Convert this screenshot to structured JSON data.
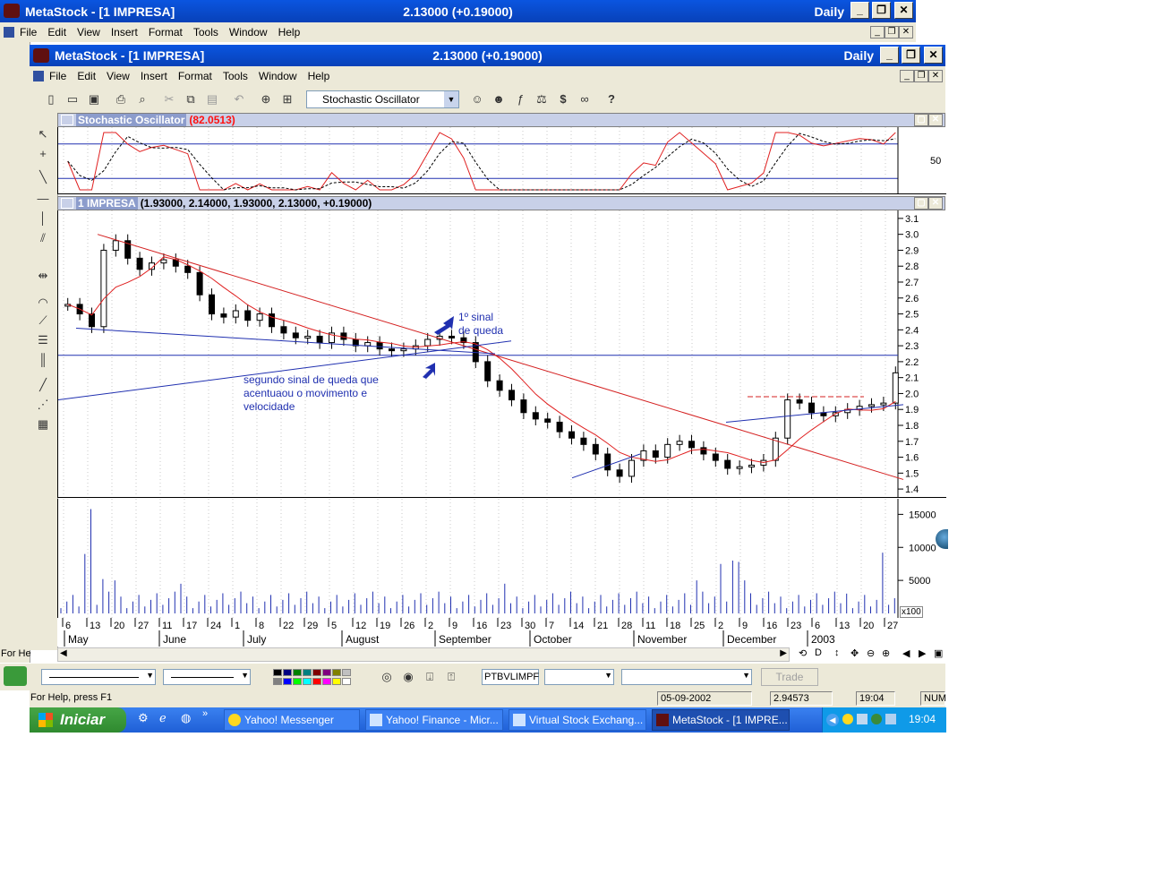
{
  "outer_window": {
    "title": "MetaStock - [1 IMPRESA]",
    "center": "2.13000 (+0.19000)",
    "period": "Daily"
  },
  "outer_menu": [
    "File",
    "Edit",
    "View",
    "Insert",
    "Format",
    "Tools",
    "Window",
    "Help"
  ],
  "inner_window": {
    "title": "MetaStock - [1 IMPRESA]",
    "center": "2.13000 (+0.19000)",
    "period": "Daily"
  },
  "inner_menu": [
    "File",
    "Edit",
    "View",
    "Insert",
    "Format",
    "Tools",
    "Window",
    "Help"
  ],
  "toolbar": {
    "indicator_select": "Stochastic Oscillator"
  },
  "stoch_pane": {
    "label": "Stochastic Oscillator",
    "value": "(82.0513)",
    "tick_50": "50"
  },
  "price_pane": {
    "label": "1 IMPRESA",
    "values": "(1.93000, 2.14000, 1.93000, 2.13000, +0.19000)"
  },
  "annotations": {
    "first_signal_line1": "1º sinal",
    "first_signal_line2": "de queda",
    "second_signal_line1": "segundo sinal de queda que",
    "second_signal_line2": "acentuaou o movimento e",
    "second_signal_line3": "velocidade"
  },
  "chart_data": {
    "type": "candlestick",
    "price_axis_ticks": [
      "3.1",
      "3.0",
      "2.9",
      "2.8",
      "2.7",
      "2.6",
      "2.5",
      "2.4",
      "2.3",
      "2.2",
      "2.1",
      "2.0",
      "1.9",
      "1.8",
      "1.7",
      "1.6",
      "1.5",
      "1.4"
    ],
    "volume_axis_ticks": [
      "15000",
      "10000",
      "5000"
    ],
    "volume_unit": "x100",
    "date_ticks": [
      "6",
      "13",
      "20",
      "27",
      "11",
      "17",
      "24",
      "1",
      "8",
      "22",
      "29",
      "5",
      "12",
      "19",
      "26",
      "2",
      "9",
      "16",
      "23",
      "30",
      "7",
      "14",
      "21",
      "28",
      "11",
      "18",
      "25",
      "2",
      "9",
      "16",
      "23",
      "6",
      "13",
      "20",
      "27"
    ],
    "months": [
      "May",
      "June",
      "July",
      "August",
      "September",
      "October",
      "November",
      "December",
      "2003"
    ],
    "close_series_approx": [
      2.56,
      2.5,
      2.42,
      2.9,
      2.96,
      2.85,
      2.78,
      2.82,
      2.84,
      2.8,
      2.76,
      2.62,
      2.5,
      2.48,
      2.52,
      2.46,
      2.5,
      2.42,
      2.38,
      2.35,
      2.36,
      2.32,
      2.38,
      2.34,
      2.3,
      2.32,
      2.28,
      2.27,
      2.28,
      2.3,
      2.34,
      2.36,
      2.35,
      2.32,
      2.2,
      2.08,
      2.02,
      1.96,
      1.88,
      1.84,
      1.82,
      1.76,
      1.72,
      1.68,
      1.62,
      1.52,
      1.48,
      1.58,
      1.64,
      1.6,
      1.68,
      1.7,
      1.66,
      1.62,
      1.58,
      1.53,
      1.54,
      1.55,
      1.58,
      1.72,
      1.96,
      1.94,
      1.88,
      1.86,
      1.88,
      1.9,
      1.92,
      1.93,
      1.94,
      2.13
    ],
    "horizontal_line": 2.24,
    "colors": {
      "candle_up": "#ffffff",
      "candle_down": "#000000",
      "trend_red": "#d42020",
      "trend_blue": "#2030b0",
      "ma": "#e02020"
    }
  },
  "bottom_toolbar": {
    "symbol": "PTBVLIMPF",
    "trade_label": "Trade"
  },
  "status": {
    "help": "For Help, press F1",
    "date": "05-09-2002",
    "value": "2.94573",
    "time": "19:04",
    "num": "NUM",
    "left_help": "For He"
  },
  "taskbar": {
    "start": "Iniciar",
    "items": [
      "Yahoo! Messenger",
      "Yahoo! Finance - Micr...",
      "Virtual Stock Exchang...",
      "MetaStock - [1 IMPRE..."
    ],
    "clock": "19:04"
  }
}
